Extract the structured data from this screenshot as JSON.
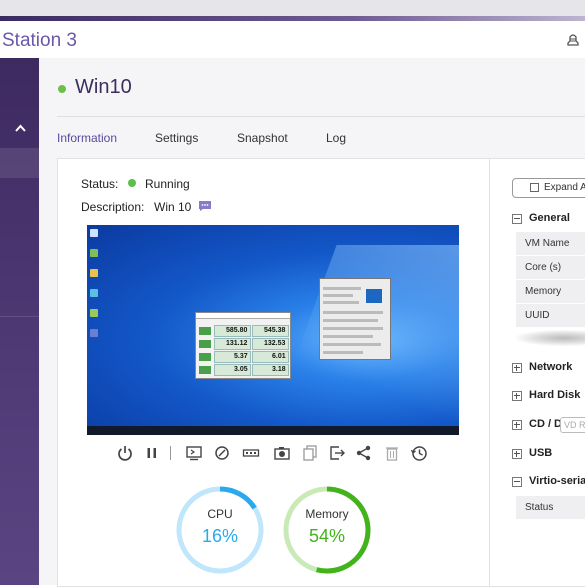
{
  "app": {
    "title": "Station 3"
  },
  "vm": {
    "name": "Win10",
    "status_color": "#6cc04a"
  },
  "tabs": [
    {
      "label": "Information",
      "active": true
    },
    {
      "label": "Settings",
      "active": false
    },
    {
      "label": "Snapshot",
      "active": false
    },
    {
      "label": "Log",
      "active": false
    }
  ],
  "info": {
    "status_label": "Status:",
    "status_value": "Running",
    "description_label": "Description:",
    "description_value": "Win 10"
  },
  "screenshot": {
    "bench_values": [
      [
        "585.80",
        "545.38"
      ],
      [
        "131.12",
        "132.53"
      ],
      [
        "5.37",
        "6.01"
      ],
      [
        "3.05",
        "3.18"
      ]
    ]
  },
  "toolbar": {
    "icons": [
      "power-icon",
      "pause-icon",
      "console-icon",
      "restart-icon",
      "usb-icon",
      "camera-icon",
      "clone-icon",
      "export-icon",
      "share-icon",
      "delete-icon",
      "schedule-icon"
    ]
  },
  "gauges": {
    "cpu": {
      "label": "CPU",
      "value": "16%",
      "percent": 16,
      "color": "#2aa9ee",
      "track": "#bfe6fb"
    },
    "memory": {
      "label": "Memory",
      "value": "54%",
      "percent": 54,
      "color": "#43b31c",
      "track": "#c9eab7"
    }
  },
  "right_panel": {
    "expand_label": "Expand Al",
    "general_label": "General",
    "general_fields": [
      "VM Name",
      "Core (s)",
      "Memory",
      "UUID"
    ],
    "sections": [
      "Network",
      "Hard Disk",
      "CD / D",
      "USB",
      "Virtio-seria"
    ],
    "cd_placeholder": "VD R",
    "virtio_fields": [
      "Status"
    ]
  }
}
